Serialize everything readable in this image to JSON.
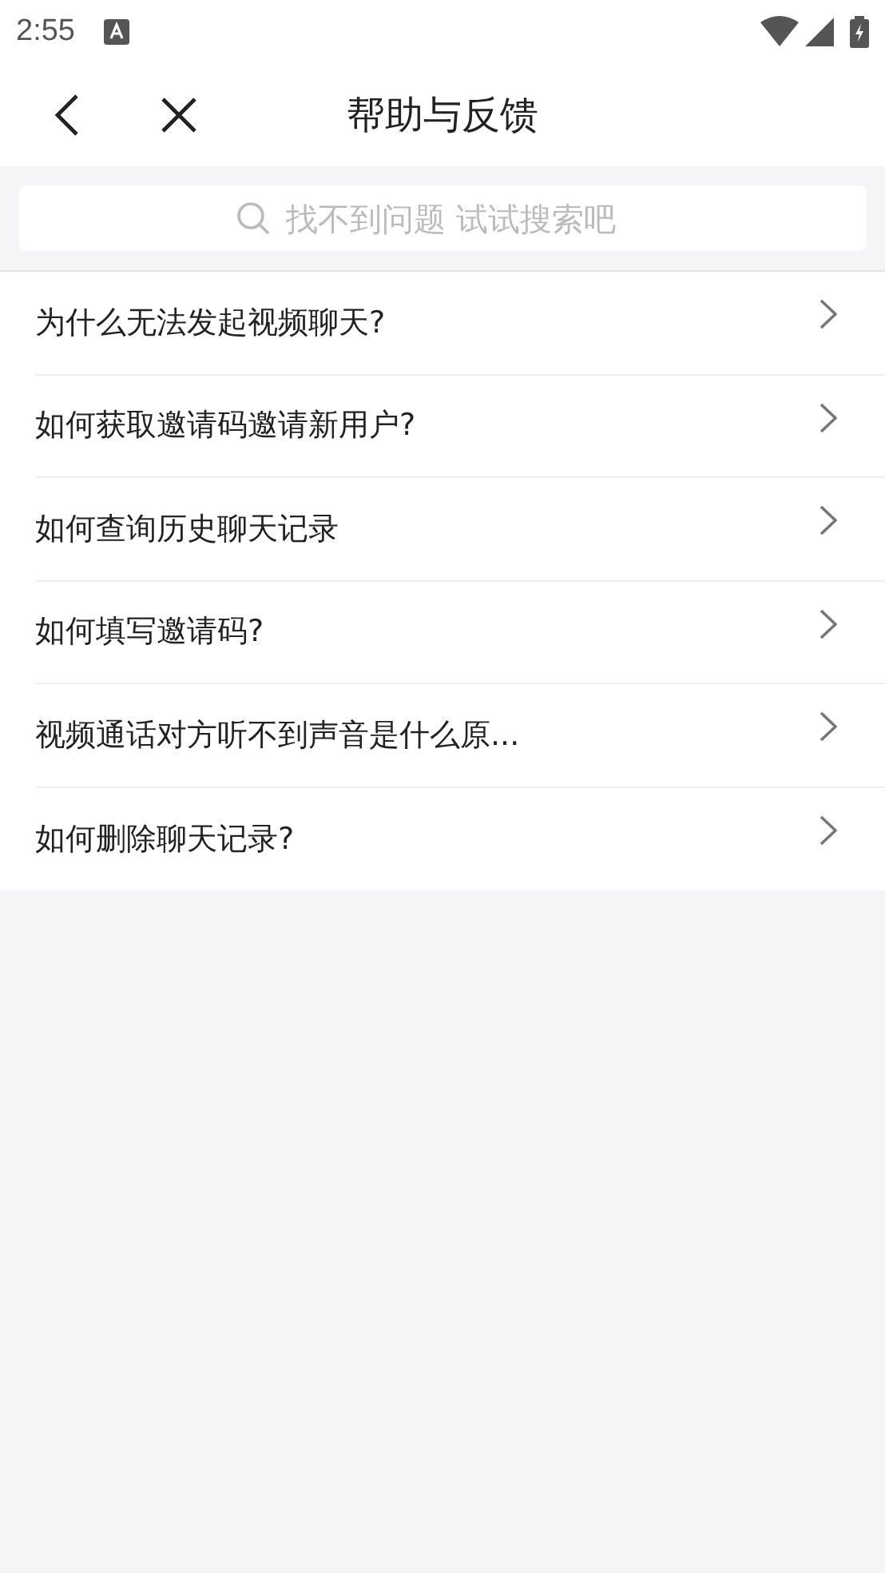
{
  "status_bar": {
    "time": "2:55"
  },
  "header": {
    "title": "帮助与反馈"
  },
  "search": {
    "placeholder": "找不到问题 试试搜索吧"
  },
  "questions": [
    {
      "text": "为什么无法发起视频聊天?"
    },
    {
      "text": "如何获取邀请码邀请新用户?"
    },
    {
      "text": "如何查询历史聊天记录"
    },
    {
      "text": "如何填写邀请码?"
    },
    {
      "text": "视频通话对方听不到声音是什么原..."
    },
    {
      "text": "如何删除聊天记录?"
    }
  ]
}
